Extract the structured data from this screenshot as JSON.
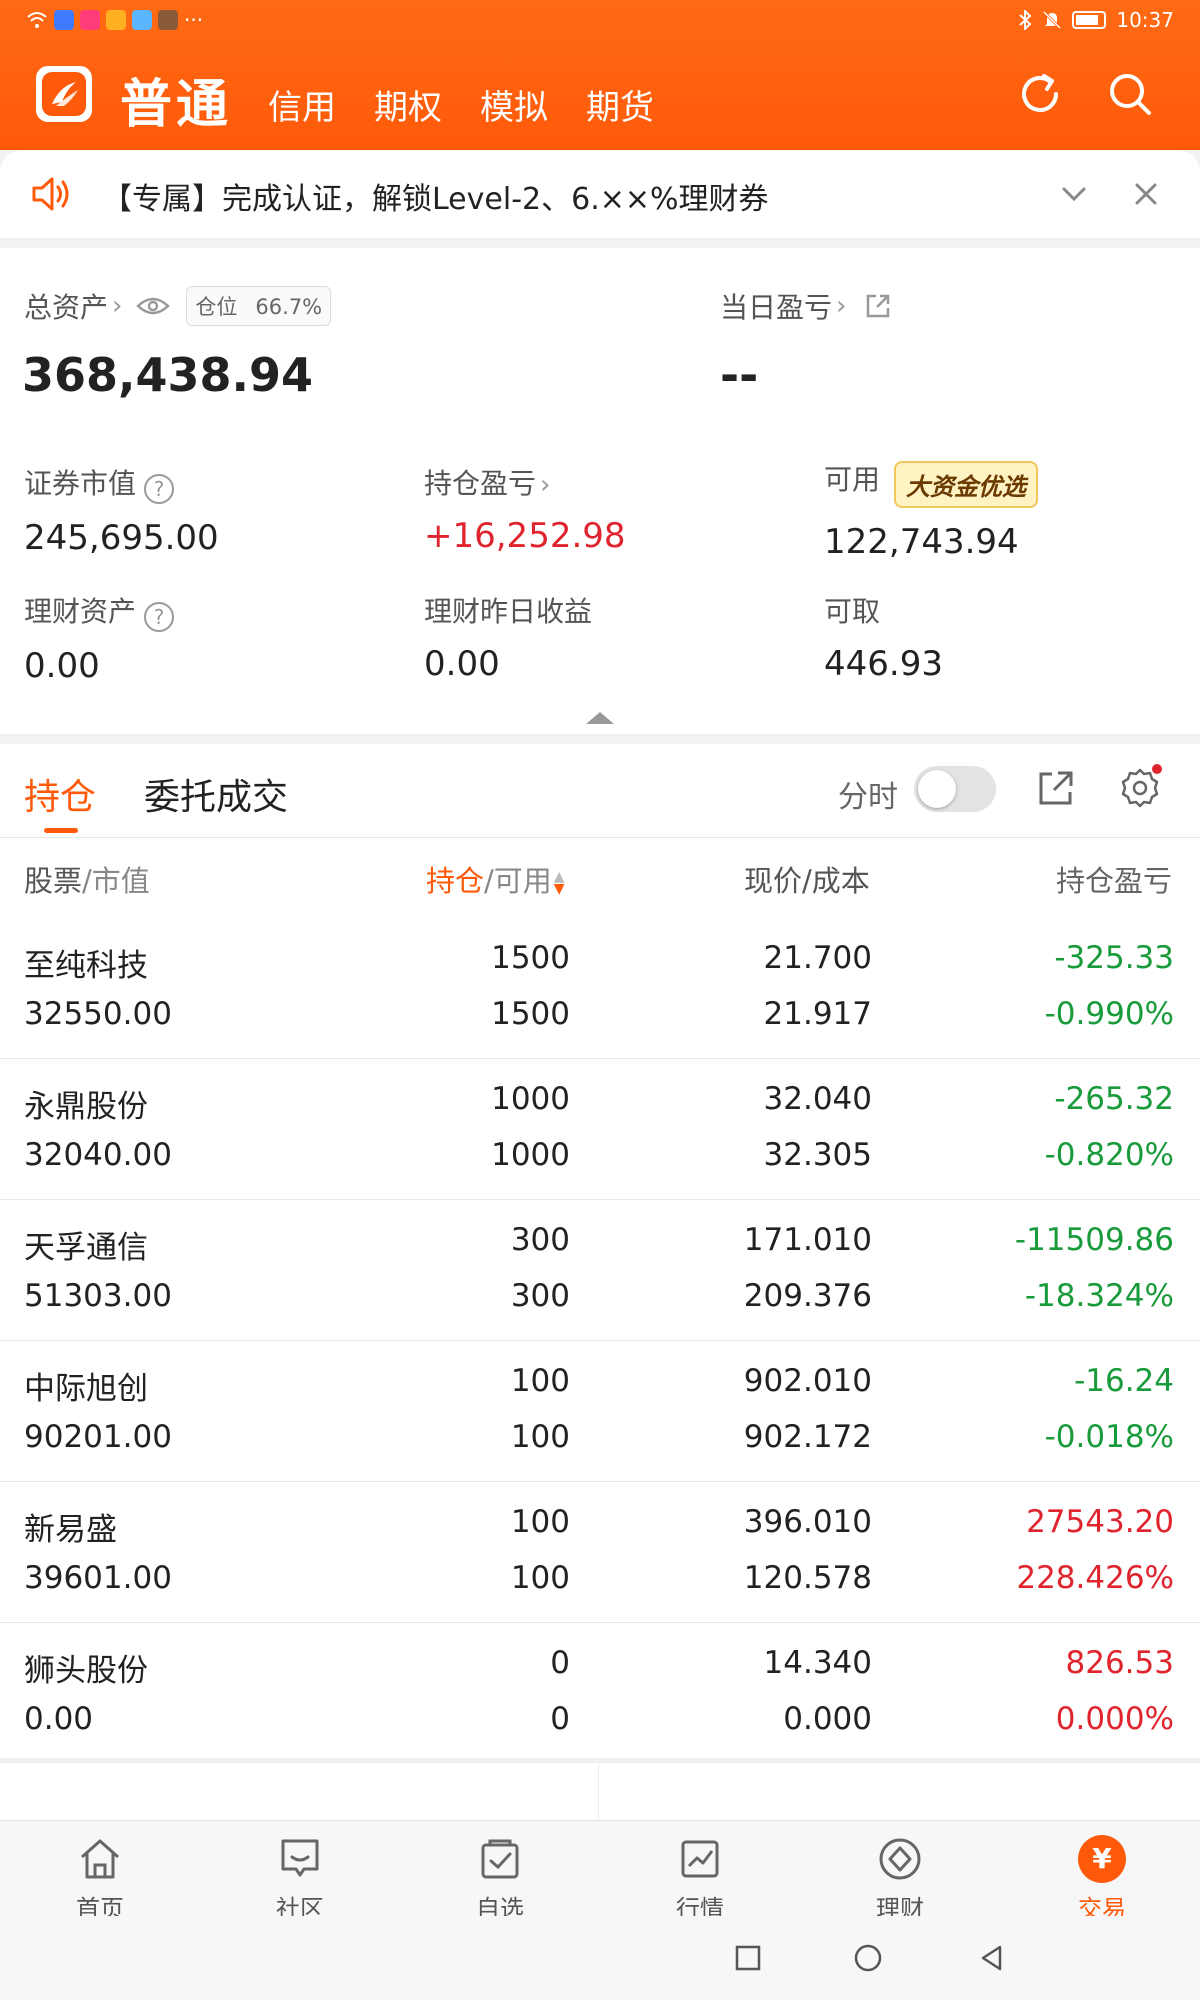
{
  "status_bar": {
    "time": "10:37",
    "overflow": "···"
  },
  "header": {
    "current_mode": "普通",
    "tabs": [
      "信用",
      "期权",
      "模拟",
      "期货"
    ],
    "accent_color": "#ff5a0a"
  },
  "notice": {
    "text": "【专属】完成认证，解锁Level-2、6.××%理财券"
  },
  "assets": {
    "total_label": "总资产",
    "position_badge_label": "仓位",
    "position_ratio": "66.7%",
    "total_value": "368,438.94",
    "day_pl_label": "当日盈亏",
    "day_pl_value": "--",
    "cells": [
      {
        "label": "证券市值",
        "value": "245,695.00"
      },
      {
        "label": "持仓盈亏",
        "value": "+16,252.98"
      },
      {
        "label": "可用",
        "value": "122,743.94",
        "badge": "大资金优选"
      },
      {
        "label": "理财资产",
        "value": "0.00"
      },
      {
        "label": "理财昨日收益",
        "value": "0.00"
      },
      {
        "label": "可取",
        "value": "446.93"
      }
    ]
  },
  "holdings_tabs": {
    "tabs": [
      "持仓",
      "委托成交"
    ],
    "active_tab": "持仓",
    "timeshare_label": "分时",
    "timeshare_on": false
  },
  "table": {
    "headers": {
      "stock": "股票",
      "market_value": "/市值",
      "position": "持仓",
      "available": "/可用",
      "price_cost": "现价/成本",
      "pl": "持仓盈亏"
    },
    "rows": [
      {
        "name": "至纯科技",
        "mv": "32550.00",
        "qty": "1500",
        "avail": "1500",
        "price": "21.700",
        "cost": "21.917",
        "pl": "-325.33",
        "pl_pct": "-0.990%",
        "trend": "down"
      },
      {
        "name": "永鼎股份",
        "mv": "32040.00",
        "qty": "1000",
        "avail": "1000",
        "price": "32.040",
        "cost": "32.305",
        "pl": "-265.32",
        "pl_pct": "-0.820%",
        "trend": "down"
      },
      {
        "name": "天孚通信",
        "mv": "51303.00",
        "qty": "300",
        "avail": "300",
        "price": "171.010",
        "cost": "209.376",
        "pl": "-11509.86",
        "pl_pct": "-18.324%",
        "trend": "down"
      },
      {
        "name": "中际旭创",
        "mv": "90201.00",
        "qty": "100",
        "avail": "100",
        "price": "902.010",
        "cost": "902.172",
        "pl": "-16.24",
        "pl_pct": "-0.018%",
        "trend": "down"
      },
      {
        "name": "新易盛",
        "mv": "39601.00",
        "qty": "100",
        "avail": "100",
        "price": "396.010",
        "cost": "120.578",
        "pl": "27543.20",
        "pl_pct": "228.426%",
        "trend": "up"
      },
      {
        "name": "狮头股份",
        "mv": "0.00",
        "qty": "0",
        "avail": "0",
        "price": "14.340",
        "cost": "0.000",
        "pl": "826.53",
        "pl_pct": "0.000%",
        "trend": "up"
      }
    ]
  },
  "bottom_nav": {
    "items": [
      "首页",
      "社区",
      "自选",
      "行情",
      "理财",
      "交易"
    ],
    "active": "交易"
  }
}
